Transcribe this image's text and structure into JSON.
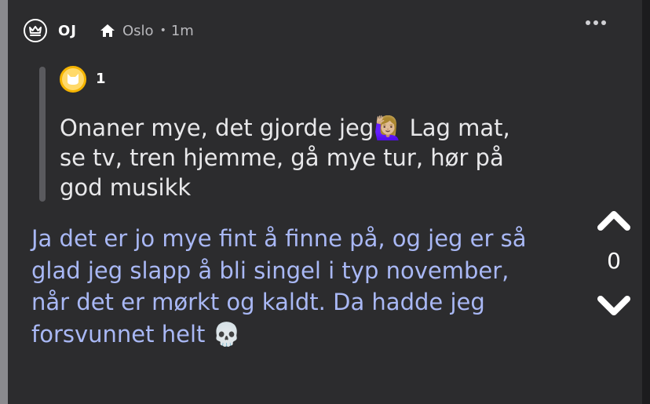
{
  "post": {
    "username": "OJ",
    "location": "Oslo",
    "separator": "•",
    "time": "1m"
  },
  "quoted": {
    "username": "1",
    "text": "Onaner mye, det gjorde jeg🙋🏼‍♀️ Lag mat, se tv, tren hjemme, gå mye tur, hør på god musikk"
  },
  "reply": {
    "text": "Ja det er jo mye fint å finne på, og jeg er så glad jeg slapp å bli singel i typ november, når det er mørkt og kaldt. Da hadde jeg forsvunnet helt 💀"
  },
  "votes": {
    "count": "0"
  },
  "icons": {
    "avatar": "crown-icon",
    "location": "home-icon",
    "menu": "more-icon",
    "quote_avatar": "cat-icon",
    "upvote": "chevron-up-icon",
    "downvote": "chevron-down-icon"
  },
  "colors": {
    "background": "#2c2c2e",
    "reply_text": "#a9b8f5",
    "quote_avatar": "#f5b400"
  }
}
